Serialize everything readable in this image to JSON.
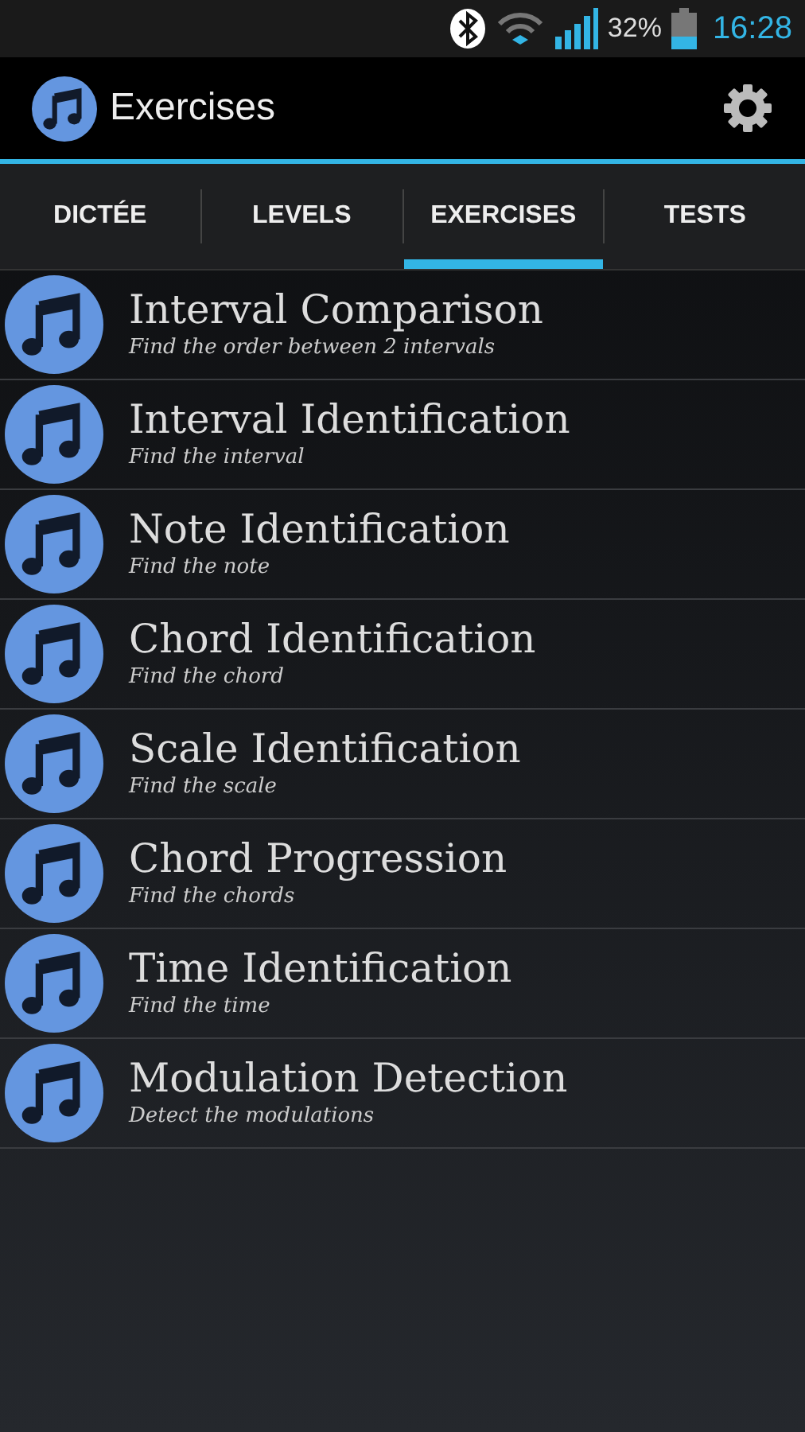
{
  "status_bar": {
    "battery": "32%",
    "time": "16:28"
  },
  "action_bar": {
    "title": "Exercises"
  },
  "tabs": [
    {
      "label": "DICTÉE",
      "selected": false
    },
    {
      "label": "LEVELS",
      "selected": false
    },
    {
      "label": "EXERCISES",
      "selected": true
    },
    {
      "label": "TESTS",
      "selected": false
    }
  ],
  "exercises": [
    {
      "title": "Interval Comparison",
      "subtitle": "Find the order between 2 intervals"
    },
    {
      "title": "Interval Identification",
      "subtitle": "Find the interval"
    },
    {
      "title": "Note Identification",
      "subtitle": "Find the note"
    },
    {
      "title": "Chord Identification",
      "subtitle": "Find the chord"
    },
    {
      "title": "Scale Identification",
      "subtitle": "Find the scale"
    },
    {
      "title": "Chord Progression",
      "subtitle": "Find the chords"
    },
    {
      "title": "Time Identification",
      "subtitle": "Find the time"
    },
    {
      "title": "Modulation Detection",
      "subtitle": "Detect the modulations"
    }
  ]
}
